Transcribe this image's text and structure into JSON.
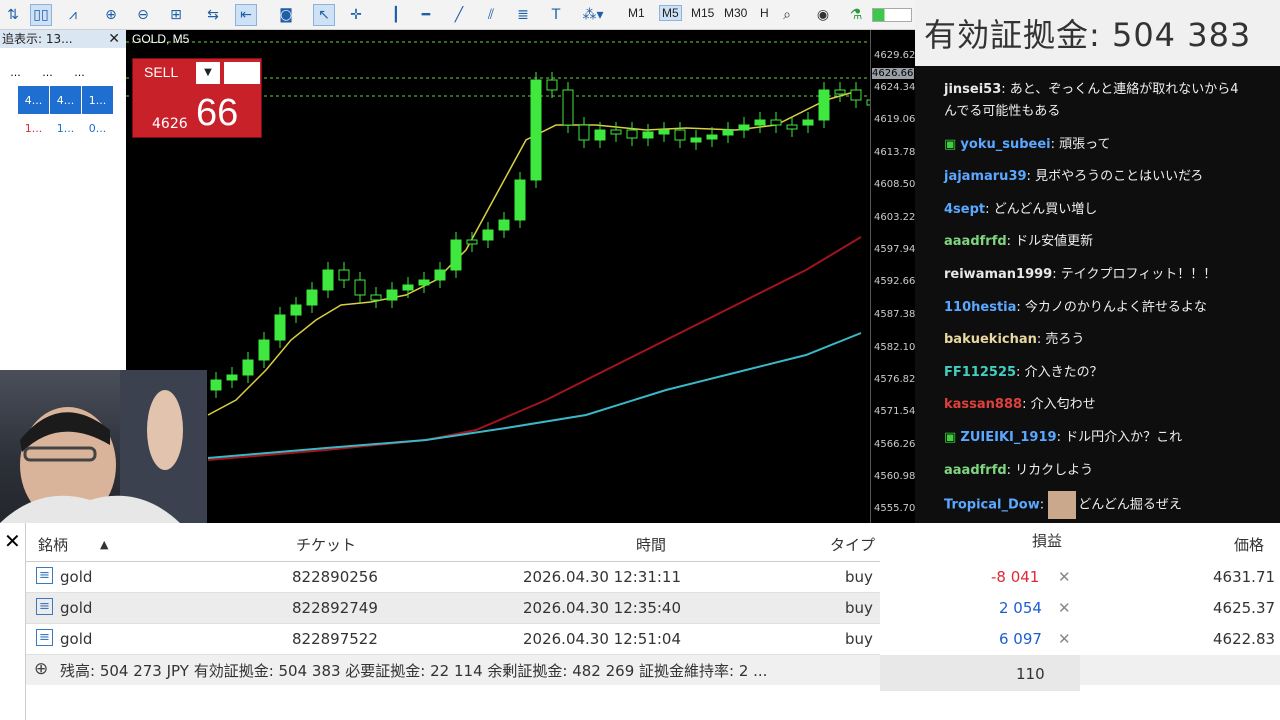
{
  "toolbar": {
    "timeframes": [
      "M1",
      "M5",
      "M15",
      "M30",
      "H"
    ],
    "active_timeframe": "M5"
  },
  "market_watch": {
    "title": "追表示: 13...",
    "close": "✕",
    "rows": [
      [
        "...",
        "...",
        "..."
      ],
      [
        "4...",
        "4...",
        "1..."
      ],
      [
        "1...",
        "1...",
        "0..."
      ]
    ]
  },
  "chart": {
    "title": "GOLD, M5",
    "sell_label": "SELL",
    "price_prefix": "4626",
    "price_big": "66",
    "current_price": "4626.66",
    "price_ticks": [
      "4629.62",
      "4624.34",
      "4619.06",
      "4613.78",
      "4608.50",
      "4603.22",
      "4597.94",
      "4592.66",
      "4587.38",
      "4582.10",
      "4576.82",
      "4571.54",
      "4566.26",
      "4560.98",
      "4555.70"
    ]
  },
  "header": {
    "title": "有効証拠金: 504 383"
  },
  "chat": [
    {
      "user": "jinsei53",
      "text": "あと、ぞっくんと連絡が取れないから4",
      "cont": "んでる可能性もある",
      "color": "#e8e8e8"
    },
    {
      "user": "yoku_subeei",
      "text": "頑張って",
      "color": "#5aa8ff",
      "badge": true
    },
    {
      "user": "jajamaru39",
      "text": "見ボやろうのことはいいだろ",
      "color": "#5aa8ff"
    },
    {
      "user": "4sept",
      "text": "どんどん買い増し",
      "color": "#5aa8ff"
    },
    {
      "user": "aaadfrfd",
      "text": "ドル安値更新",
      "color": "#7fd67f"
    },
    {
      "user": "reiwaman1999",
      "text": "テイクプロフィット！！！",
      "color": "#e8e8e8"
    },
    {
      "user": "110hestia",
      "text": "今カノのかりんよく許せるよな",
      "color": "#5aa8ff"
    },
    {
      "user": "bakuekichan",
      "text": "売ろう",
      "color": "#e8d8a0"
    },
    {
      "user": "FF112525",
      "text": "介入きたの？",
      "color": "#40d0c0"
    },
    {
      "user": "kassan888",
      "text": "介入匂わせ",
      "color": "#e0403a"
    },
    {
      "user": "ZUIEIKI_1919",
      "text": "ドル円介入か？これ",
      "color": "#5aa8ff",
      "badge": true
    },
    {
      "user": "aaadfrfd",
      "text": "リカクしよう",
      "color": "#7fd67f"
    },
    {
      "user": "Tropical_Dow",
      "text": "どんどん掘るぜえ",
      "color": "#5aa8ff",
      "avatar": true
    }
  ],
  "table": {
    "headers": [
      "銘柄",
      "チケット",
      "時間",
      "タイプ",
      "損益",
      "価格"
    ],
    "rows": [
      {
        "symbol": "gold",
        "ticket": "822890256",
        "time": "2026.04.30 12:31:11",
        "type": "buy",
        "profit": "-8 041",
        "price": "4631.71",
        "neg": true
      },
      {
        "symbol": "gold",
        "ticket": "822892749",
        "time": "2026.04.30 12:35:40",
        "type": "buy",
        "profit": "2 054",
        "price": "4625.37",
        "neg": false
      },
      {
        "symbol": "gold",
        "ticket": "822897522",
        "time": "2026.04.30 12:51:04",
        "type": "buy",
        "profit": "6 097",
        "price": "4622.83",
        "neg": false
      }
    ],
    "status": "残高: 504 273 JPY  有効証拠金: 504 383  必要証拠金: 22 114  余剰証拠金: 482 269  証拠金維持率: 2 ...",
    "total": "110"
  }
}
